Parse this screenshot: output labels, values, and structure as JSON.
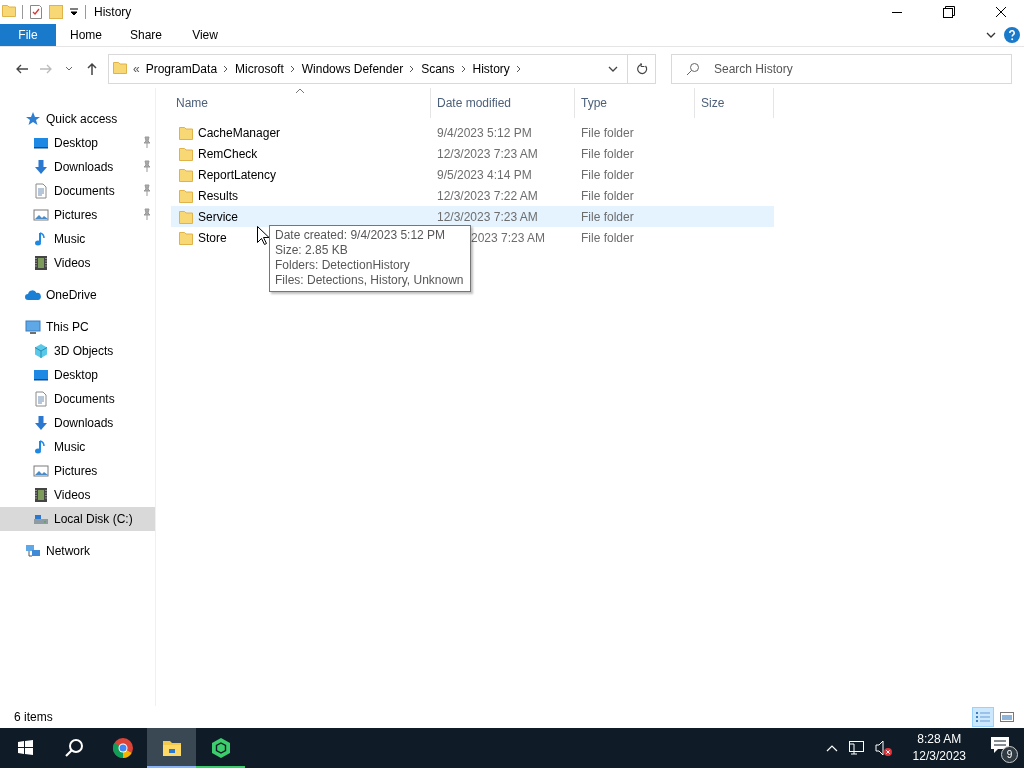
{
  "window": {
    "title": "History"
  },
  "ribbon": {
    "tabs": [
      {
        "label": "File",
        "kind": "file"
      },
      {
        "label": "Home",
        "kind": "tab"
      },
      {
        "label": "Share",
        "kind": "tab"
      },
      {
        "label": "View",
        "kind": "tab"
      }
    ]
  },
  "address_bar": {
    "overflow": "«",
    "path": [
      "ProgramData",
      "Microsoft",
      "Windows Defender",
      "Scans",
      "History"
    ]
  },
  "search": {
    "placeholder": "Search History"
  },
  "navigation": [
    {
      "label": "Quick access",
      "kind": "star",
      "selected": false,
      "children": [
        {
          "label": "Desktop",
          "kind": "desktop",
          "pinned": true,
          "selected": false
        },
        {
          "label": "Downloads",
          "kind": "downloads",
          "pinned": true,
          "selected": false
        },
        {
          "label": "Documents",
          "kind": "documents",
          "pinned": true,
          "selected": false
        },
        {
          "label": "Pictures",
          "kind": "pictures",
          "pinned": true,
          "selected": false
        },
        {
          "label": "Music",
          "kind": "music",
          "pinned": false,
          "selected": false
        },
        {
          "label": "Videos",
          "kind": "videos",
          "pinned": false,
          "selected": false
        }
      ]
    },
    {
      "label": "OneDrive",
      "kind": "cloud",
      "selected": false
    },
    {
      "label": "This PC",
      "kind": "pc",
      "selected": false,
      "children": [
        {
          "label": "3D Objects",
          "kind": "cube",
          "selected": false
        },
        {
          "label": "Desktop",
          "kind": "desktop",
          "selected": false
        },
        {
          "label": "Documents",
          "kind": "documents",
          "selected": false
        },
        {
          "label": "Downloads",
          "kind": "downloads",
          "selected": false
        },
        {
          "label": "Music",
          "kind": "music",
          "selected": false
        },
        {
          "label": "Pictures",
          "kind": "pictures",
          "selected": false
        },
        {
          "label": "Videos",
          "kind": "videos",
          "selected": false
        },
        {
          "label": "Local Disk (C:)",
          "kind": "disk",
          "selected": true
        }
      ]
    },
    {
      "label": "Network",
      "kind": "network",
      "selected": false
    }
  ],
  "columns": [
    {
      "label": "Name",
      "sorted": true
    },
    {
      "label": "Date modified",
      "sorted": false
    },
    {
      "label": "Type",
      "sorted": false
    },
    {
      "label": "Size",
      "sorted": false
    }
  ],
  "rows": [
    {
      "name": "CacheManager",
      "date_modified": "9/4/2023 5:12 PM",
      "type": "File folder",
      "hovered": false
    },
    {
      "name": "RemCheck",
      "date_modified": "12/3/2023 7:23 AM",
      "type": "File folder",
      "hovered": false
    },
    {
      "name": "ReportLatency",
      "date_modified": "9/5/2023 4:14 PM",
      "type": "File folder",
      "hovered": false
    },
    {
      "name": "Results",
      "date_modified": "12/3/2023 7:22 AM",
      "type": "File folder",
      "hovered": false
    },
    {
      "name": "Service",
      "date_modified": "12/3/2023 7:23 AM",
      "type": "File folder",
      "hovered": true
    },
    {
      "name": "Store",
      "date_modified": "2023 7:23 AM",
      "date_covered": true,
      "type": "File folder",
      "hovered": false
    }
  ],
  "tooltip": {
    "lines": [
      "Date created: 9/4/2023 5:12 PM",
      "Size: 2.85 KB",
      "Folders: DetectionHistory",
      "Files: Detections, History, Unknown"
    ]
  },
  "status_bar": {
    "item_count": "6 items",
    "views": [
      {
        "kind": "details",
        "selected": true
      },
      {
        "kind": "tiles",
        "selected": false
      }
    ]
  },
  "taskbar": {
    "apps": [
      {
        "kind": "start",
        "active": false,
        "running": false
      },
      {
        "kind": "search",
        "active": false,
        "running": false
      },
      {
        "kind": "chrome",
        "active": false,
        "running": false
      },
      {
        "kind": "explorer",
        "active": true,
        "running": true
      },
      {
        "kind": "kaspersky",
        "active": false,
        "running": true
      }
    ],
    "clock": {
      "time": "8:28 AM",
      "date": "12/3/2023"
    },
    "notification_count": "9"
  }
}
